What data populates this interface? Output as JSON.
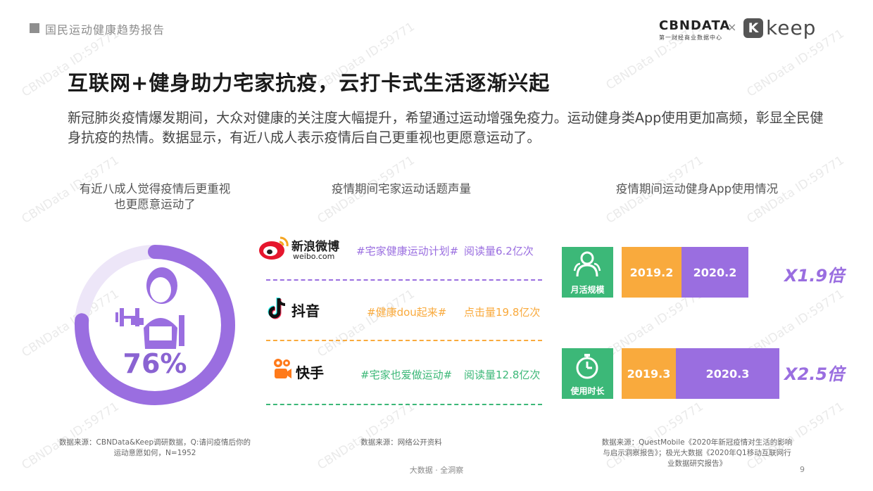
{
  "header": {
    "report_title": "国民运动健康趋势报告",
    "brand_cbn": "CBNDATA",
    "brand_cbn_sub": "第一财经商业数据中心",
    "brand_times": "×",
    "brand_keep_mark": "K",
    "brand_keep": "keep"
  },
  "title": "互联网+健身助力宅家抗疫，云打卡式生活逐渐兴起",
  "description": "新冠肺炎疫情爆发期间，大众对健康的关注度大幅提升，希望通过运动增强免疫力。运动健身类App使用更加高频，彰显全民健身抗疫的热情。数据显示，有近八成人表示疫情后自己更重视也更愿意运动了。",
  "left": {
    "title_line1": "有近八成人觉得疫情后更重视",
    "title_line2": "也更愿意运动了",
    "percent_label": "76%",
    "percent_value": 0.76,
    "ring_color": "#9a6ee0",
    "track_color": "#ede6f8",
    "source_line1": "数据来源：CBNData&Keep调研数据，Q:请问疫情后你的",
    "source_line2": "运动意愿如何，N=1952"
  },
  "middle": {
    "title": "疫情期间宅家运动话题声量",
    "rows": [
      {
        "platform": "新浪微博",
        "platform_sub": "weibo.com",
        "tag": "#宅家健康运动计划#",
        "stat": "阅读量6.2亿次",
        "color": "#9a6ee0"
      },
      {
        "platform": "抖音",
        "platform_sub": "",
        "tag": "#健康dou起来#",
        "stat": "点击量19.8亿次",
        "color": "#f9aa3d"
      },
      {
        "platform": "快手",
        "platform_sub": "",
        "tag": "#宅家也爱做运动#",
        "stat": "阅读量12.8亿次",
        "color": "#3cb878"
      }
    ],
    "source": "数据来源：网络公开资料"
  },
  "right": {
    "title": "疫情期间运动健身App使用情况",
    "rows": [
      {
        "label": "月活规模",
        "icon": "people-icon",
        "before": "2019.2",
        "after": "2020.2",
        "multiplier": "X1.9倍"
      },
      {
        "label": "使用时长",
        "icon": "stopwatch-icon",
        "before": "2019.3",
        "after": "2020.3",
        "multiplier": "X2.5倍"
      }
    ],
    "source_line1": "数据来源：QuestMobile《2020年新冠疫情对生活的影响",
    "source_line2": "与启示洞察报告》；极光大数据《2020年Q1移动互联网行",
    "source_line3": "业数据研究报告》"
  },
  "footer": {
    "text": "大数据 · 全洞察",
    "page": "9"
  },
  "watermark": "CBNData ID:59771"
}
